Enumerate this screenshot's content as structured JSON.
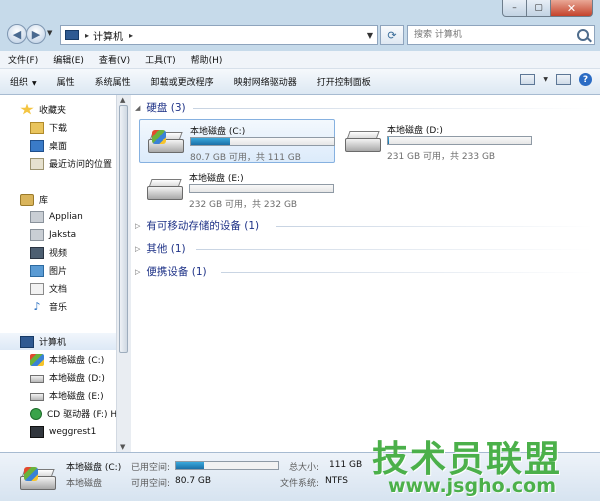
{
  "window": {
    "min_glyph": "–",
    "max_glyph": "▢",
    "close_glyph": "✕"
  },
  "address": {
    "crumb": "计算机",
    "search_placeholder": "搜索 计算机"
  },
  "menu": [
    "文件(F)",
    "编辑(E)",
    "查看(V)",
    "工具(T)",
    "帮助(H)"
  ],
  "commands": {
    "organize": "组织",
    "properties": "属性",
    "system_properties": "系统属性",
    "uninstall": "卸载或更改程序",
    "map_drive": "映射网络驱动器",
    "control_panel": "打开控制面板"
  },
  "nav": {
    "favorites": "收藏夹",
    "downloads": "下载",
    "desktop": "桌面",
    "recent": "最近访问的位置",
    "libraries": "库",
    "lib_items": [
      "Applian",
      "Jaksta",
      "视频",
      "图片",
      "文档",
      "音乐"
    ],
    "computer": "计算机",
    "drives": [
      "本地磁盘 (C:)",
      "本地磁盘 (D:)",
      "本地磁盘 (E:)",
      "CD 驱动器 (F:) H",
      "weggrest1"
    ]
  },
  "groups": {
    "hdd": "硬盘 (3)",
    "removable": "有可移动存储的设备 (1)",
    "other": "其他 (1)",
    "portable": "便携设备 (1)"
  },
  "drives": [
    {
      "name": "本地磁盘 (C:)",
      "size_text": "80.7 GB 可用，共 111 GB",
      "used_fraction": 0.27
    },
    {
      "name": "本地磁盘 (D:)",
      "size_text": "231 GB 可用，共 233 GB",
      "used_fraction": 0.01
    },
    {
      "name": "本地磁盘 (E:)",
      "size_text": "232 GB 可用，共 232 GB",
      "used_fraction": 0.0
    }
  ],
  "details": {
    "name": "本地磁盘 (C:)",
    "type": "本地磁盘",
    "used_label": "已用空间:",
    "free_label": "可用空间:",
    "free_value": "80.7 GB",
    "total_label": "总大小:",
    "total_value": "111 GB",
    "fs_label": "文件系统:",
    "fs_value": "NTFS",
    "used_fraction": 0.27
  },
  "watermark": {
    "text": "技术员联盟",
    "url": "www.jsgho.com"
  },
  "colors": {
    "accent": "#1e3287",
    "progress": "#2a8ccc",
    "watermark": "#4bb04a"
  }
}
